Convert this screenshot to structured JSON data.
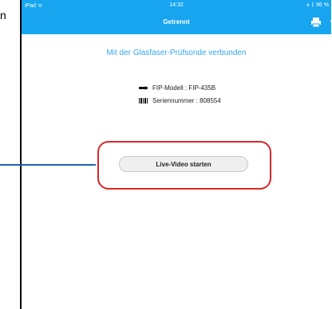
{
  "page_fragment": "n",
  "statusbar": {
    "left": "iPad ᯤ",
    "time": "14:32",
    "right": "✈ ᛒ 96 %"
  },
  "navbar": {
    "title": "Getrennt",
    "more": "‹",
    "icon": "printer-icon"
  },
  "main": {
    "headline": "Mit der Glasfaser-Prüfsonde verbunden",
    "model": "FIP-Modell : FIP-435B",
    "serial": "Seriennummer : 808554",
    "model_icon": "probe-icon",
    "serial_icon": "barcode-icon",
    "live_button": "Live-Video starten"
  },
  "colors": {
    "nav_bar": "#17a5f0",
    "headline": "#35a6ea",
    "callout_ring": "#d9262a",
    "callout_line": "#1c62b5"
  }
}
